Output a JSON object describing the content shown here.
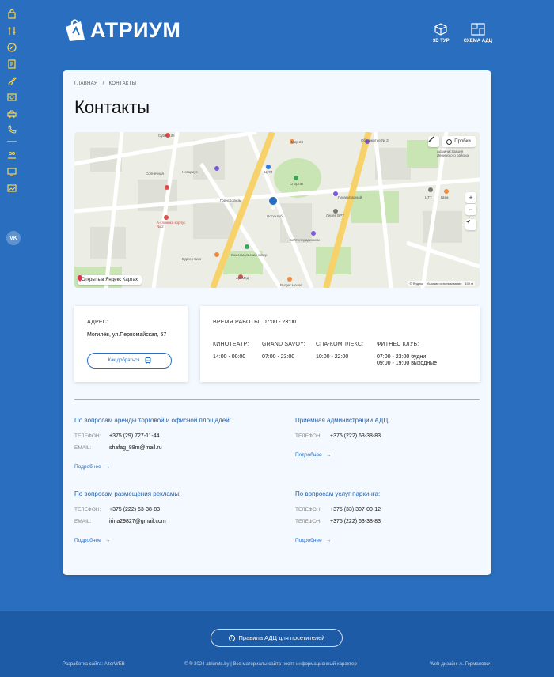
{
  "brand": {
    "name": "АТРИУМ"
  },
  "header": {
    "tour_label": "3D ТУР",
    "scheme_label": "СХЕМА АДЦ"
  },
  "sidebar": {
    "icons": [
      "bag-icon",
      "tools-icon",
      "discount-icon",
      "document-icon",
      "brush-icon",
      "photo-icon",
      "car-icon",
      "phone-icon",
      "people-icon",
      "monitor-icon",
      "gallery-icon"
    ],
    "vk_label": "VK"
  },
  "breadcrumbs": [
    "ГЛАВНАЯ",
    "/",
    "КОНТАКТЫ"
  ],
  "page_title": "Контакты",
  "map": {
    "open_label": "Открыть в Яндекс Картах",
    "traffic_label": "Пробки",
    "yandex_label": "© Яндекс",
    "terms_label": "Условия использования",
    "scale_label": "100 м",
    "zoom_in": "+",
    "zoom_out": "−",
    "labels": [
      "Cyber Life",
      "Мир 23",
      "Общежитие № 3",
      "Спортак",
      "ЦУМ",
      "Горисполком",
      "Фотоклуб",
      "Гуманитарный",
      "Лицей БРУ",
      "Белтелерадиоком",
      "Солнечная",
      "Комсомольский сквер",
      "Бургер Кинг",
      "Burger House",
      "АртМед",
      "Нотариус",
      "Администрация Ленинского района",
      "Шэм",
      "ЦТТ",
      "А-клиника корпус № 2"
    ]
  },
  "address": {
    "label": "АДРЕС:",
    "value": "Могилёв, ул.Первомайская, 57",
    "route_button": "Как добраться"
  },
  "hours": {
    "label": "ВРЕМЯ РАБОТЫ:",
    "value": "07:00 - 23:00",
    "columns": [
      {
        "title": "КИНОТЕАТР:",
        "lines": [
          "14:00 - 00:00"
        ]
      },
      {
        "title": "GRAND SAVOY:",
        "lines": [
          "07:00 - 23:00"
        ]
      },
      {
        "title": "СПА-КОМПЛЕКС:",
        "lines": [
          "10:00 - 22:00"
        ]
      },
      {
        "title": "ФИТНЕС КЛУБ:",
        "lines": [
          "07:00 - 23:00 будни",
          "09:00 - 19:00 выходные"
        ]
      }
    ]
  },
  "contacts": [
    {
      "title": "По вопросам аренды торговой и офисной площадей:",
      "rows": [
        {
          "label": "ТЕЛЕФОН:",
          "value": "+375 (29) 727-11-44"
        },
        {
          "label": "EMAIL:",
          "value": "shafag_88m@mail.ru"
        }
      ],
      "more": "Подробнее"
    },
    {
      "title": "Приемная администрации АДЦ:",
      "rows": [
        {
          "label": "ТЕЛЕФОН:",
          "value": "+375 (222) 63-38-83"
        }
      ],
      "more": "Подробнее"
    },
    {
      "title": "По вопросам размещения рекламы:",
      "rows": [
        {
          "label": "ТЕЛЕФОН:",
          "value": "+375 (222) 63-38-83"
        },
        {
          "label": "EMAIL:",
          "value": "irina29827@gmail.com"
        }
      ],
      "more": "Подробнее"
    },
    {
      "title": "По вопросам услуг паркинга:",
      "rows": [
        {
          "label": "ТЕЛЕФОН:",
          "value": "+375 (33) 307-00-12"
        },
        {
          "label": "ТЕЛЕФОН:",
          "value": "+375 (222) 63-38-83"
        }
      ],
      "more": "Подробнее"
    }
  ],
  "footer": {
    "rules_button": "Правила АДЦ для посетителей",
    "dev": "Разработка сайта: AlterWEB",
    "copyright": "© ® 2024 atriumtc.by | Все материалы сайта носят информационный характер",
    "design": "Web-дизайн: А. Германович"
  },
  "colors": {
    "background": "#2a6fbf",
    "footer": "#1d5ba6",
    "card": "#f3f9fe",
    "accent": "#2a6fbf"
  }
}
